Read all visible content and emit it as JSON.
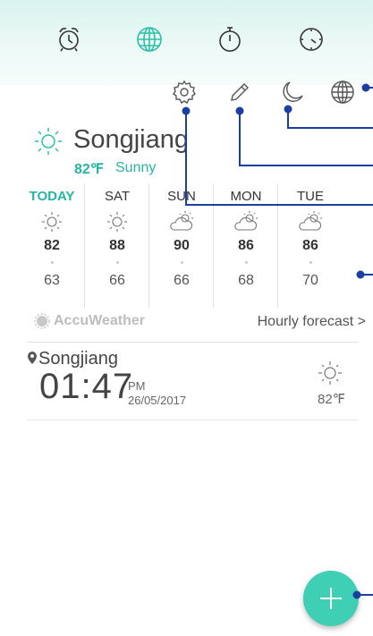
{
  "tabs": [
    {
      "icon": "alarm-clock-icon"
    },
    {
      "icon": "globe-icon",
      "active": true
    },
    {
      "icon": "stopwatch-icon"
    },
    {
      "icon": "timer-icon"
    }
  ],
  "toolbar": {
    "icons": [
      "gear-icon",
      "pencil-icon",
      "moon-icon",
      "globe-icon"
    ]
  },
  "weather": {
    "city": "Songjiang",
    "temperature": "82℉",
    "condition": "Sunny",
    "forecast": [
      {
        "day": "TODAY",
        "icon": "sun-icon",
        "high": "82",
        "low": "63"
      },
      {
        "day": "SAT",
        "icon": "sun-icon",
        "high": "88",
        "low": "66"
      },
      {
        "day": "SUN",
        "icon": "partly-cloudy-icon",
        "high": "90",
        "low": "66"
      },
      {
        "day": "MON",
        "icon": "partly-cloudy-icon",
        "high": "86",
        "low": "68"
      },
      {
        "day": "TUE",
        "icon": "partly-cloudy-icon",
        "high": "86",
        "low": "70"
      }
    ],
    "provider": "AccuWeather",
    "hourly_link": "Hourly forecast >"
  },
  "city_card": {
    "city": "Songjiang",
    "time": "01:47",
    "ampm": "PM",
    "date": "26/05/2017",
    "temperature": "82℉"
  },
  "colors": {
    "accent": "#26b5a3",
    "fab": "#3fcfb4",
    "callout": "#1a3fa0"
  }
}
